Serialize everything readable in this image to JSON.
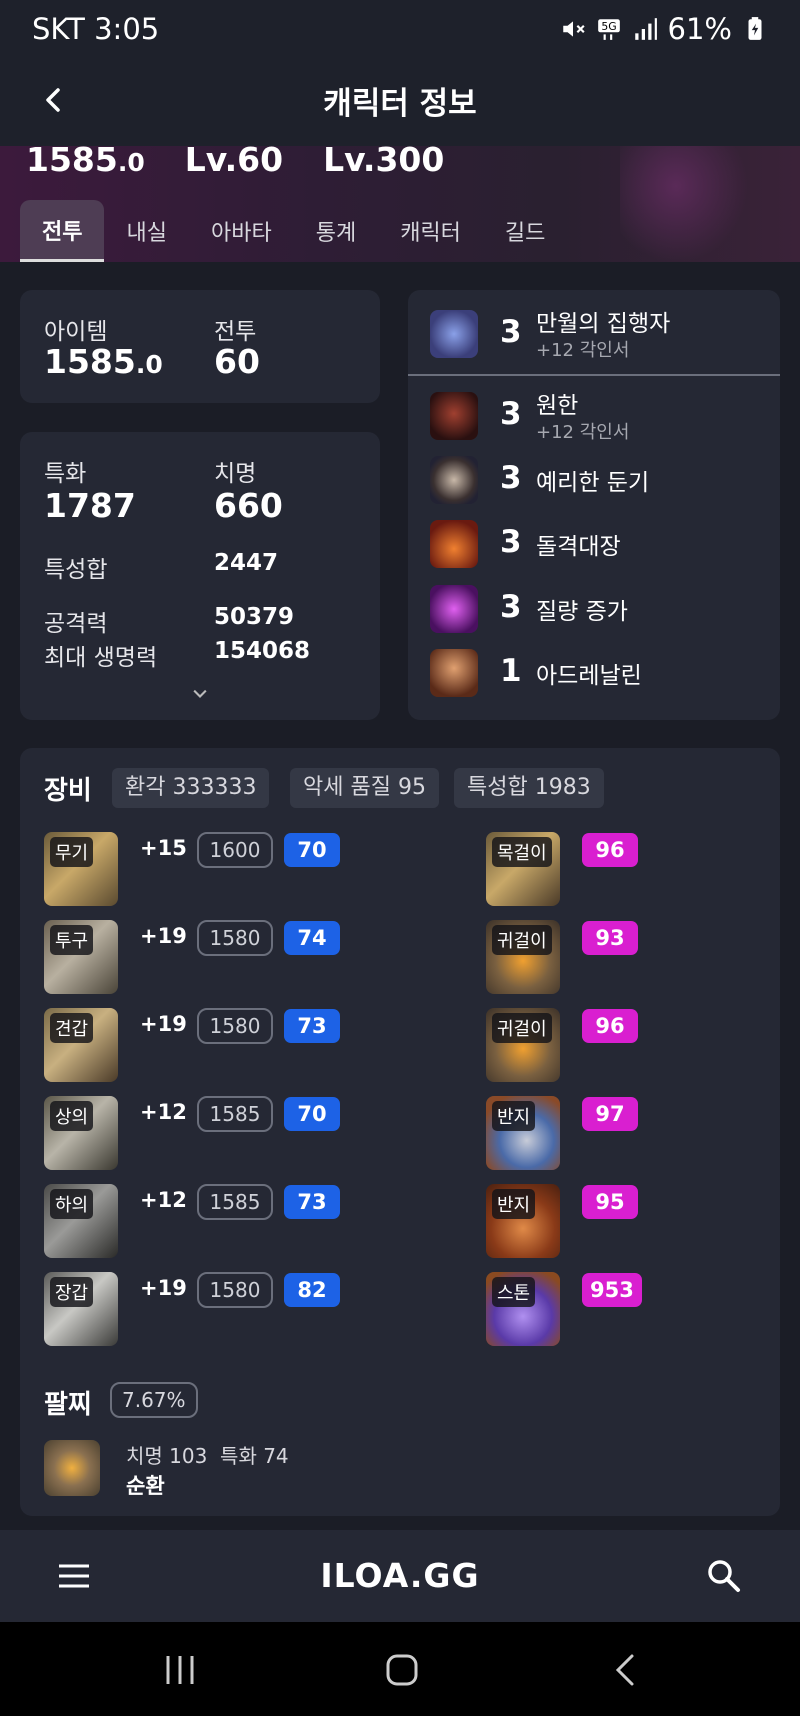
{
  "status_bar": {
    "carrier_time": "SKT 3:05",
    "battery": "61%"
  },
  "header": {
    "title": "캐릭터 정보"
  },
  "hero": {
    "item_level": "1585",
    "item_level_dec": ".0",
    "combat_level": "Lv.60",
    "expedition_level": "Lv.300"
  },
  "tabs": [
    "전투",
    "내실",
    "아바타",
    "통계",
    "캐릭터",
    "길드"
  ],
  "summary": {
    "item_label": "아이템",
    "item_value": "1585",
    "item_value_dec": ".0",
    "combat_label": "전투",
    "combat_value": "60"
  },
  "stats": {
    "spec_label": "특화",
    "spec_value": "1787",
    "crit_label": "치명",
    "crit_value": "660",
    "total_label": "특성합",
    "total_value": "2447",
    "atk_label": "공격력",
    "atk_value": "50379",
    "hp_label": "최대 생명력",
    "hp_value": "154068"
  },
  "engravings": [
    {
      "level": "3",
      "name": "만월의 집행자",
      "sub": "+12 각인서",
      "icon": "moon-executor-icon",
      "color": "#6a7fd0"
    },
    {
      "level": "3",
      "name": "원한",
      "sub": "+12 각인서",
      "icon": "grudge-icon",
      "color": "#8a3a2a"
    },
    {
      "level": "3",
      "name": "예리한 둔기",
      "sub": "",
      "icon": "keen-blunt-icon",
      "color": "#5a4a44"
    },
    {
      "level": "3",
      "name": "돌격대장",
      "sub": "",
      "icon": "raid-captain-icon",
      "color": "#c0482a"
    },
    {
      "level": "3",
      "name": "질량 증가",
      "sub": "",
      "icon": "mass-increase-icon",
      "color": "#a02ac0"
    },
    {
      "level": "1",
      "name": "아드레날린",
      "sub": "",
      "icon": "adrenaline-icon",
      "color": "#a06040"
    }
  ],
  "equipment": {
    "title": "장비",
    "chips": [
      "환각 333333",
      "악세 품질 95",
      "특성합 1983"
    ],
    "gear": [
      {
        "tag": "무기",
        "plus": "+15",
        "level": "1600",
        "quality": "70"
      },
      {
        "tag": "투구",
        "plus": "+19",
        "level": "1580",
        "quality": "74"
      },
      {
        "tag": "견갑",
        "plus": "+19",
        "level": "1580",
        "quality": "73"
      },
      {
        "tag": "상의",
        "plus": "+12",
        "level": "1585",
        "quality": "70"
      },
      {
        "tag": "하의",
        "plus": "+12",
        "level": "1585",
        "quality": "73"
      },
      {
        "tag": "장갑",
        "plus": "+19",
        "level": "1580",
        "quality": "82"
      }
    ],
    "accessories": [
      {
        "tag": "목걸이",
        "quality": "96"
      },
      {
        "tag": "귀걸이",
        "quality": "93"
      },
      {
        "tag": "귀걸이",
        "quality": "96"
      },
      {
        "tag": "반지",
        "quality": "97"
      },
      {
        "tag": "반지",
        "quality": "95"
      },
      {
        "tag": "스톤",
        "quality": "953"
      }
    ]
  },
  "bracelet": {
    "title": "팔찌",
    "percent": "7.67%",
    "stats": "치명 103  특화 74",
    "effect": "순환"
  },
  "bottom_nav": {
    "logo": "ILOA.GG"
  }
}
